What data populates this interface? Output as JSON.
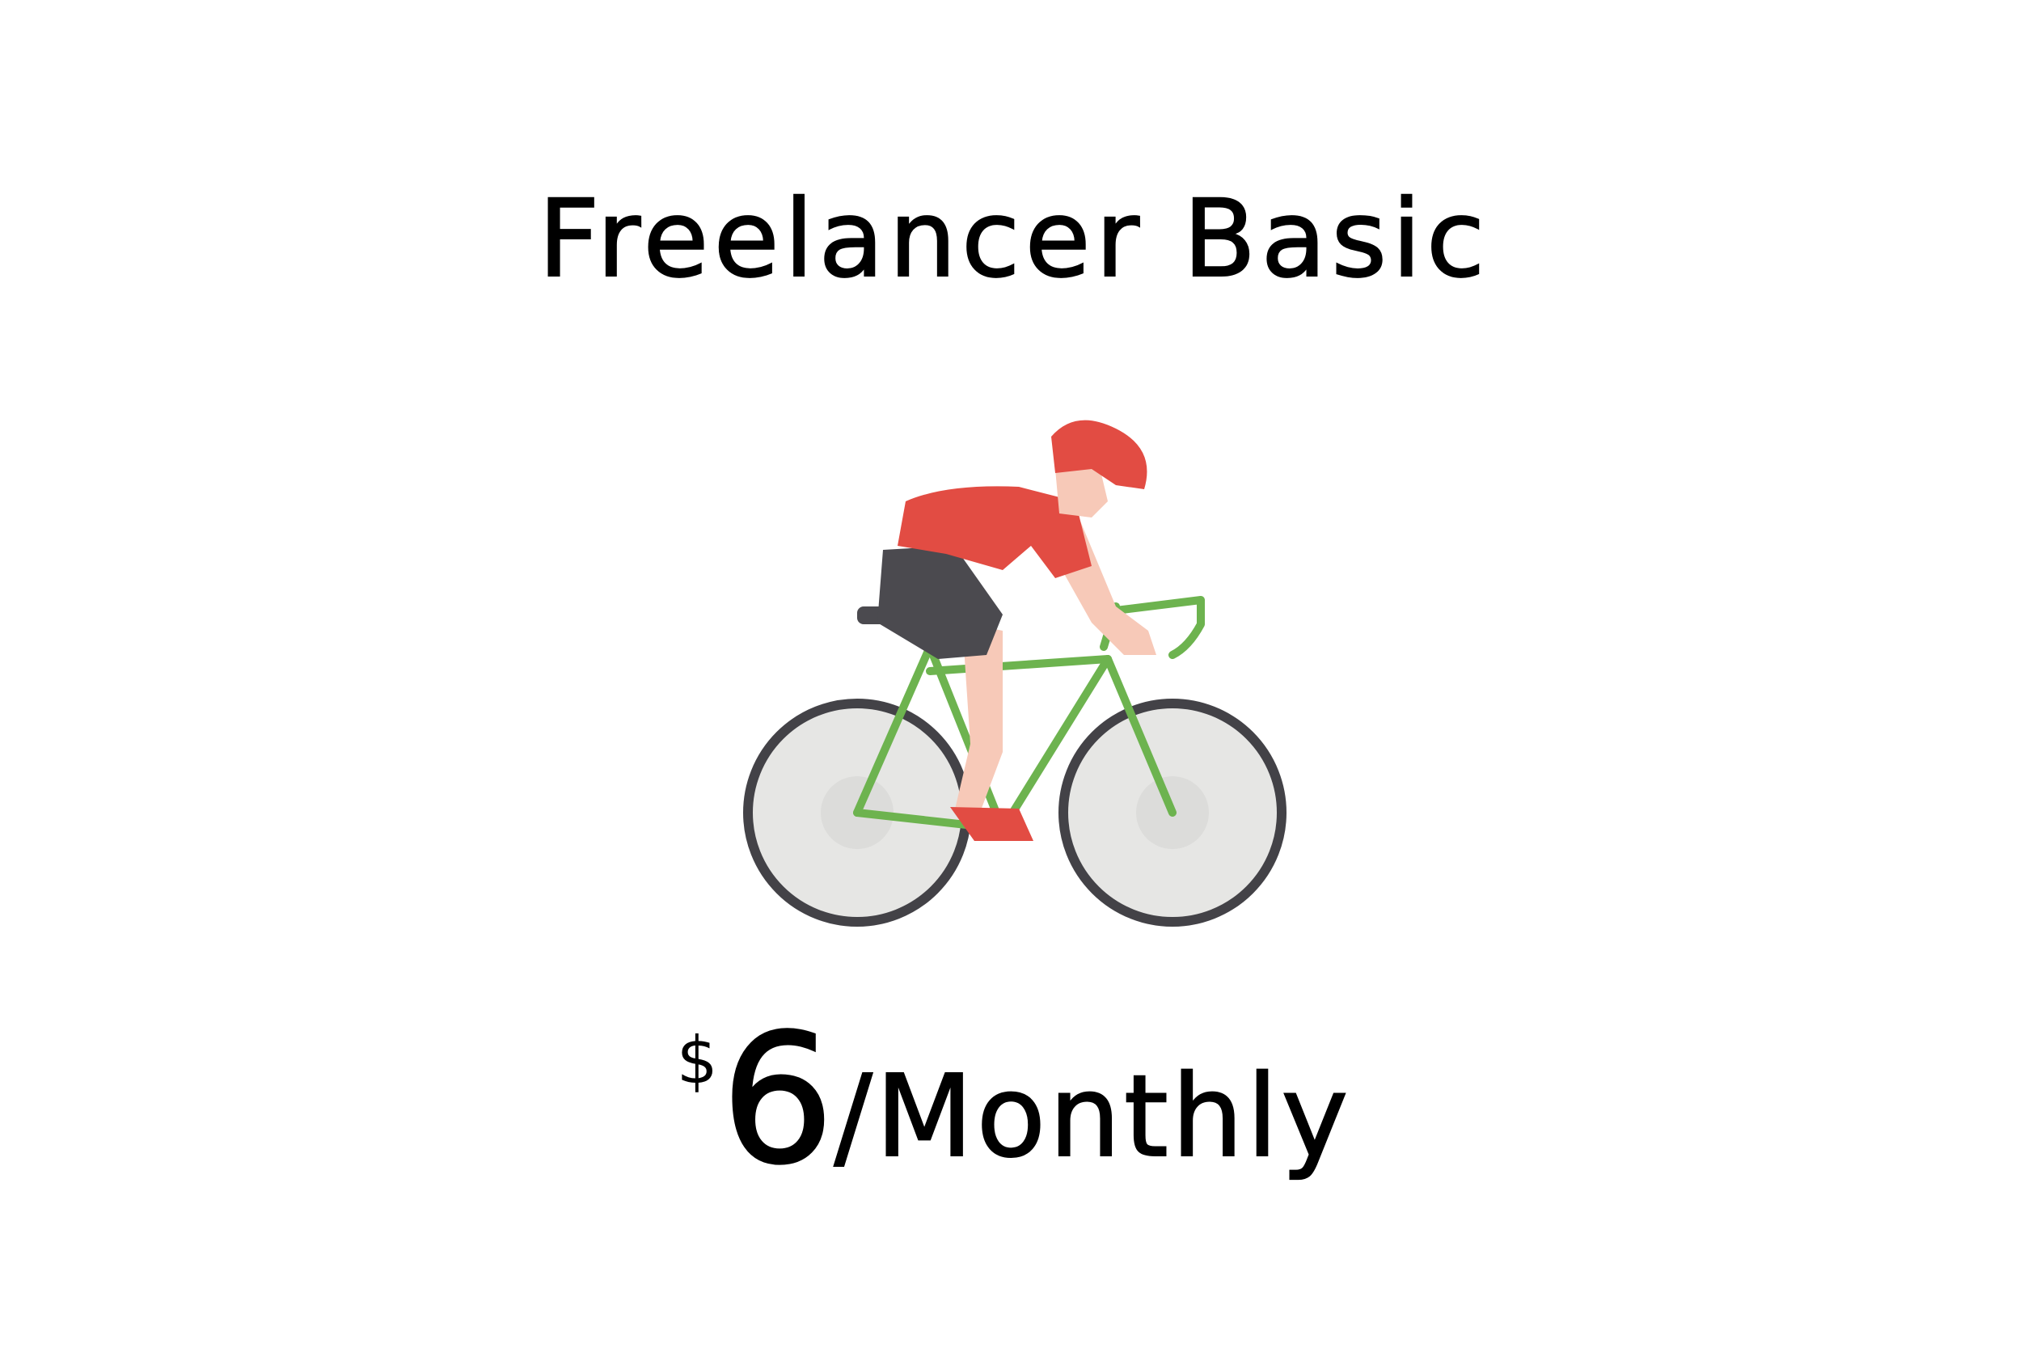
{
  "plan": {
    "title": "Freelancer Basic",
    "icon": "cyclist-icon",
    "price": {
      "currency": "$",
      "amount": "6",
      "period": "/Monthly"
    }
  },
  "colors": {
    "jersey": "#e24c43",
    "helmet": "#e24c43",
    "shorts": "#4b4a4f",
    "skin": "#f7c9b8",
    "frame": "#6db34f",
    "tire": "#434247",
    "wheel_fill": "#e6e6e4",
    "shoe": "#e24c43"
  }
}
